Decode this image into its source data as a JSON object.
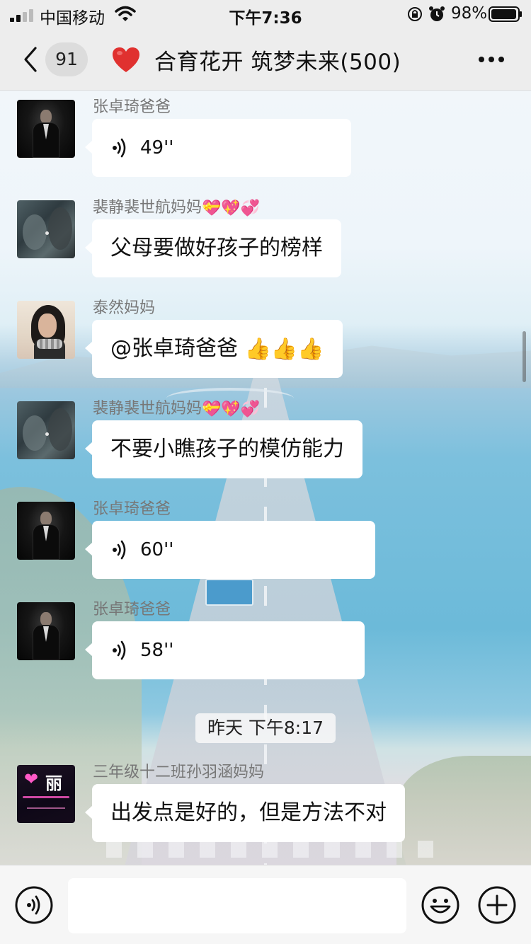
{
  "status_bar": {
    "carrier": "中国移动",
    "time": "下午7:36",
    "battery": "98%"
  },
  "header": {
    "unread_count": "91",
    "title": "合育花开 筑梦未来(500)",
    "title_icon": "heart-icon"
  },
  "messages": [
    {
      "sender": "张卓琦爸爸",
      "type": "voice",
      "duration": "49''",
      "avatar": "dad"
    },
    {
      "sender": "裴静裴世航妈妈",
      "sender_emojis": "💝💖💞",
      "type": "text",
      "text": "父母要做好孩子的榜样",
      "avatar": "pei"
    },
    {
      "sender": "泰然妈妈",
      "type": "text",
      "text": "@张卓琦爸爸 ",
      "text_emojis": "👍👍👍",
      "avatar": "tai"
    },
    {
      "sender": "裴静裴世航妈妈",
      "sender_emojis": "💝💖💞",
      "type": "text",
      "text": "不要小瞧孩子的模仿能力",
      "avatar": "pei"
    },
    {
      "sender": "张卓琦爸爸",
      "type": "voice",
      "duration": "60''",
      "avatar": "dad"
    },
    {
      "sender": "张卓琦爸爸",
      "type": "voice",
      "duration": "58''",
      "avatar": "dad"
    },
    {
      "sender": "三年级十二班孙羽涵妈妈",
      "type": "text",
      "text": "出发点是好的，但是方法不对",
      "avatar": "sun",
      "avatar_text": "丽"
    }
  ],
  "timestamp": "昨天 下午8:17",
  "input": {
    "value": "",
    "placeholder": ""
  },
  "colors": {
    "bar_background": "#ededed",
    "bubble": "#ffffff",
    "heart": "#e0312f"
  }
}
